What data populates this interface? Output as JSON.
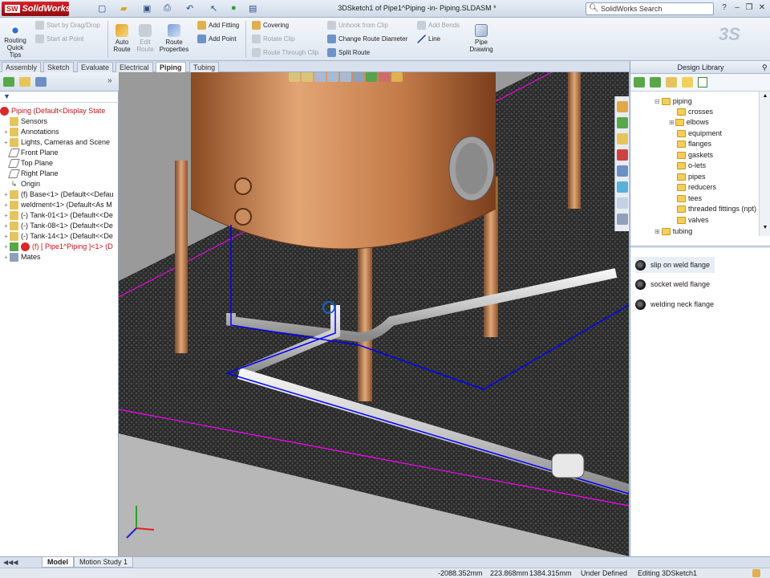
{
  "titlebar": {
    "app_name": "SolidWorks",
    "document_title": "3DSketch1 of Pipe1^Piping -in- Piping.SLDASM *",
    "search_placeholder": "SolidWorks Search"
  },
  "ribbon": {
    "routing_quick_tips": "Routing Quick Tips",
    "start_by_drag_drop": "Start by Drag/Drop",
    "start_at_point": "Start at Point",
    "auto_route": "Auto Route",
    "edit_route": "Edit Route",
    "route_properties": "Route Properties",
    "add_fitting": "Add Fitting",
    "add_point": "Add Point",
    "covering": "Covering",
    "rotate_clip": "Rotate Clip",
    "route_through_clip": "Route Through Clip",
    "unhook_from_clip": "Unhook from Clip",
    "change_route_diameter": "Change Route Diameter",
    "split_route": "Split Route",
    "add_bends": "Add Bends",
    "line": "Line",
    "pipe_drawing": "Pipe Drawing"
  },
  "tabs": [
    "Assembly",
    "Sketch",
    "Evaluate",
    "Electrical",
    "Piping",
    "Tubing"
  ],
  "active_tab": "Piping",
  "feature_tree": {
    "root": "Piping  (Default<Display State",
    "items": [
      "Sensors",
      "Annotations",
      "Lights, Cameras and Scene",
      "Front Plane",
      "Top Plane",
      "Right Plane",
      "Origin",
      "(f) Base<1> (Default<<Defau",
      "weldment<1> (Default<As M",
      "(-) Tank-01<1> (Default<<De",
      "(-) Tank-08<1> (Default<<De",
      "(-) Tank-14<1> (Default<<De",
      "(f) [ Pipe1^Piping ]<1> (D",
      "Mates"
    ]
  },
  "design_library": {
    "title": "Design Library",
    "folders": [
      "piping",
      "crosses",
      "elbows",
      "equipment",
      "flanges",
      "gaskets",
      "o-lets",
      "pipes",
      "reducers",
      "tees",
      "threaded fittings (npt)",
      "valves",
      "tubing"
    ],
    "parts": [
      "slip on weld flange",
      "socket weld flange",
      "welding neck flange"
    ]
  },
  "bottom_tabs": [
    "Model",
    "Motion Study 1"
  ],
  "status": {
    "x": "-2088.352mm",
    "y": "223.868mm",
    "z": "1384.315mm",
    "state": "Under Defined",
    "editing": "Editing 3DSketch1"
  },
  "colors": {
    "accent": "#c0141a",
    "route_line": "#0000ff",
    "plane_line": "#ff00ff",
    "tank": "#c97f4e",
    "ribbon_bg": "#dde6f1"
  }
}
